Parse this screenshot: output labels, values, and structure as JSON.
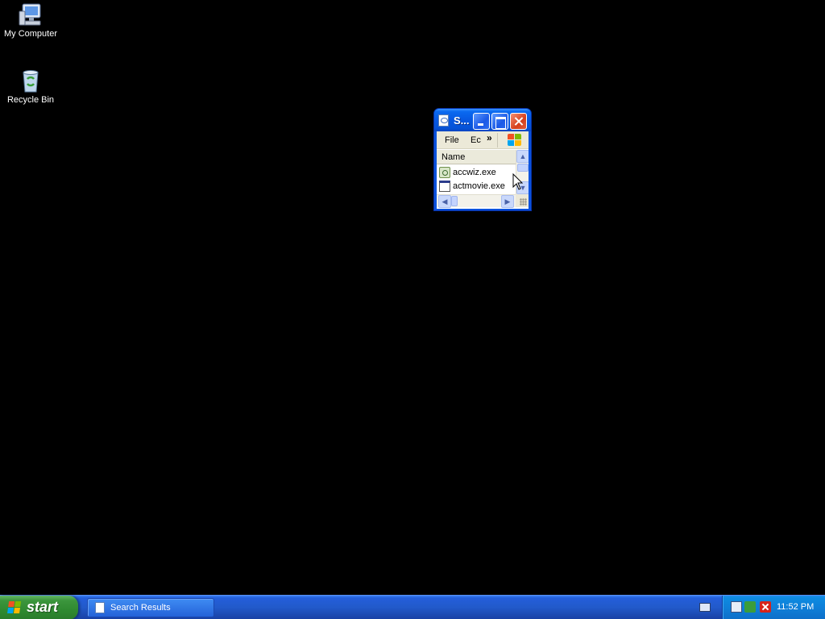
{
  "desktop": {
    "icons": [
      {
        "label": "My Computer",
        "icon": "my-computer-icon"
      },
      {
        "label": "Recycle Bin",
        "icon": "recycle-bin-icon"
      }
    ]
  },
  "window": {
    "title": "S...",
    "icon": "search-results-icon",
    "menus": {
      "file": "File",
      "edit": "Ec",
      "overflow": "»"
    },
    "column_header": "Name",
    "files": [
      {
        "name": "accwiz.exe",
        "icon": "accessibility-wizard-icon"
      },
      {
        "name": "actmovie.exe",
        "icon": "application-window-icon"
      }
    ]
  },
  "taskbar": {
    "start_label": "start",
    "task_buttons": [
      {
        "label": "Search Results",
        "icon": "search-results-icon"
      }
    ],
    "clock": "11:52 PM"
  },
  "colors": {
    "desktop_background": "#000000",
    "titlebar_blue": "#0758e2",
    "taskbar_blue": "#245edb",
    "start_green": "#3c963d",
    "tray_blue": "#0f7fd8",
    "close_red": "#d6401c"
  }
}
